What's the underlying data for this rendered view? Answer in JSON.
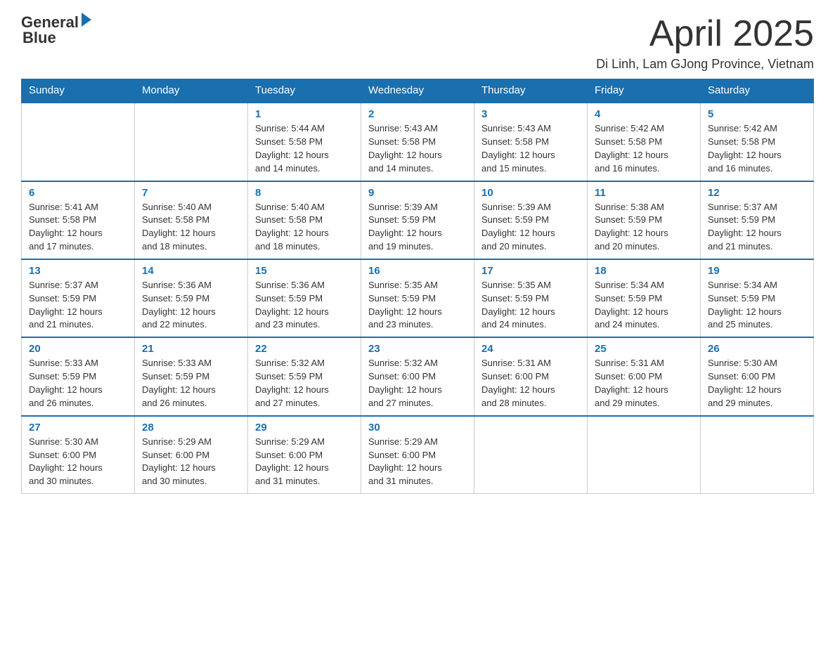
{
  "header": {
    "logo_text_general": "General",
    "logo_text_blue": "Blue",
    "month_title": "April 2025",
    "location": "Di Linh, Lam GJong Province, Vietnam"
  },
  "calendar": {
    "days_of_week": [
      "Sunday",
      "Monday",
      "Tuesday",
      "Wednesday",
      "Thursday",
      "Friday",
      "Saturday"
    ],
    "weeks": [
      [
        {
          "day": "",
          "info": ""
        },
        {
          "day": "",
          "info": ""
        },
        {
          "day": "1",
          "info": "Sunrise: 5:44 AM\nSunset: 5:58 PM\nDaylight: 12 hours\nand 14 minutes."
        },
        {
          "day": "2",
          "info": "Sunrise: 5:43 AM\nSunset: 5:58 PM\nDaylight: 12 hours\nand 14 minutes."
        },
        {
          "day": "3",
          "info": "Sunrise: 5:43 AM\nSunset: 5:58 PM\nDaylight: 12 hours\nand 15 minutes."
        },
        {
          "day": "4",
          "info": "Sunrise: 5:42 AM\nSunset: 5:58 PM\nDaylight: 12 hours\nand 16 minutes."
        },
        {
          "day": "5",
          "info": "Sunrise: 5:42 AM\nSunset: 5:58 PM\nDaylight: 12 hours\nand 16 minutes."
        }
      ],
      [
        {
          "day": "6",
          "info": "Sunrise: 5:41 AM\nSunset: 5:58 PM\nDaylight: 12 hours\nand 17 minutes."
        },
        {
          "day": "7",
          "info": "Sunrise: 5:40 AM\nSunset: 5:58 PM\nDaylight: 12 hours\nand 18 minutes."
        },
        {
          "day": "8",
          "info": "Sunrise: 5:40 AM\nSunset: 5:58 PM\nDaylight: 12 hours\nand 18 minutes."
        },
        {
          "day": "9",
          "info": "Sunrise: 5:39 AM\nSunset: 5:59 PM\nDaylight: 12 hours\nand 19 minutes."
        },
        {
          "day": "10",
          "info": "Sunrise: 5:39 AM\nSunset: 5:59 PM\nDaylight: 12 hours\nand 20 minutes."
        },
        {
          "day": "11",
          "info": "Sunrise: 5:38 AM\nSunset: 5:59 PM\nDaylight: 12 hours\nand 20 minutes."
        },
        {
          "day": "12",
          "info": "Sunrise: 5:37 AM\nSunset: 5:59 PM\nDaylight: 12 hours\nand 21 minutes."
        }
      ],
      [
        {
          "day": "13",
          "info": "Sunrise: 5:37 AM\nSunset: 5:59 PM\nDaylight: 12 hours\nand 21 minutes."
        },
        {
          "day": "14",
          "info": "Sunrise: 5:36 AM\nSunset: 5:59 PM\nDaylight: 12 hours\nand 22 minutes."
        },
        {
          "day": "15",
          "info": "Sunrise: 5:36 AM\nSunset: 5:59 PM\nDaylight: 12 hours\nand 23 minutes."
        },
        {
          "day": "16",
          "info": "Sunrise: 5:35 AM\nSunset: 5:59 PM\nDaylight: 12 hours\nand 23 minutes."
        },
        {
          "day": "17",
          "info": "Sunrise: 5:35 AM\nSunset: 5:59 PM\nDaylight: 12 hours\nand 24 minutes."
        },
        {
          "day": "18",
          "info": "Sunrise: 5:34 AM\nSunset: 5:59 PM\nDaylight: 12 hours\nand 24 minutes."
        },
        {
          "day": "19",
          "info": "Sunrise: 5:34 AM\nSunset: 5:59 PM\nDaylight: 12 hours\nand 25 minutes."
        }
      ],
      [
        {
          "day": "20",
          "info": "Sunrise: 5:33 AM\nSunset: 5:59 PM\nDaylight: 12 hours\nand 26 minutes."
        },
        {
          "day": "21",
          "info": "Sunrise: 5:33 AM\nSunset: 5:59 PM\nDaylight: 12 hours\nand 26 minutes."
        },
        {
          "day": "22",
          "info": "Sunrise: 5:32 AM\nSunset: 5:59 PM\nDaylight: 12 hours\nand 27 minutes."
        },
        {
          "day": "23",
          "info": "Sunrise: 5:32 AM\nSunset: 6:00 PM\nDaylight: 12 hours\nand 27 minutes."
        },
        {
          "day": "24",
          "info": "Sunrise: 5:31 AM\nSunset: 6:00 PM\nDaylight: 12 hours\nand 28 minutes."
        },
        {
          "day": "25",
          "info": "Sunrise: 5:31 AM\nSunset: 6:00 PM\nDaylight: 12 hours\nand 29 minutes."
        },
        {
          "day": "26",
          "info": "Sunrise: 5:30 AM\nSunset: 6:00 PM\nDaylight: 12 hours\nand 29 minutes."
        }
      ],
      [
        {
          "day": "27",
          "info": "Sunrise: 5:30 AM\nSunset: 6:00 PM\nDaylight: 12 hours\nand 30 minutes."
        },
        {
          "day": "28",
          "info": "Sunrise: 5:29 AM\nSunset: 6:00 PM\nDaylight: 12 hours\nand 30 minutes."
        },
        {
          "day": "29",
          "info": "Sunrise: 5:29 AM\nSunset: 6:00 PM\nDaylight: 12 hours\nand 31 minutes."
        },
        {
          "day": "30",
          "info": "Sunrise: 5:29 AM\nSunset: 6:00 PM\nDaylight: 12 hours\nand 31 minutes."
        },
        {
          "day": "",
          "info": ""
        },
        {
          "day": "",
          "info": ""
        },
        {
          "day": "",
          "info": ""
        }
      ]
    ]
  }
}
